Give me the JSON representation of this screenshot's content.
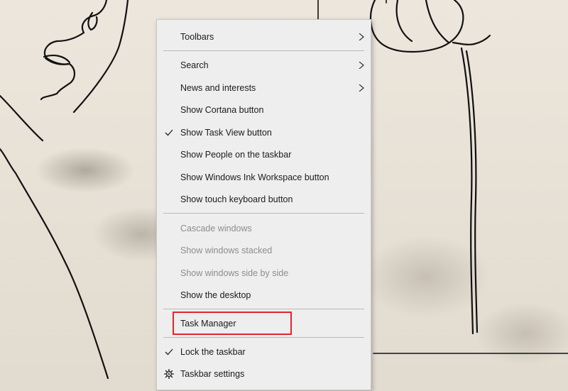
{
  "context_menu": {
    "items": [
      {
        "label": "Toolbars",
        "submenu": true
      },
      {
        "label": "Search",
        "submenu": true
      },
      {
        "label": "News and interests",
        "submenu": true
      },
      {
        "label": "Show Cortana button"
      },
      {
        "label": "Show Task View button",
        "checked": true
      },
      {
        "label": "Show People on the taskbar"
      },
      {
        "label": "Show Windows Ink Workspace button"
      },
      {
        "label": "Show touch keyboard button"
      },
      {
        "label": "Cascade windows",
        "disabled": true
      },
      {
        "label": "Show windows stacked",
        "disabled": true
      },
      {
        "label": "Show windows side by side",
        "disabled": true
      },
      {
        "label": "Show the desktop"
      },
      {
        "label": "Task Manager",
        "highlighted": true
      },
      {
        "label": "Lock the taskbar",
        "checked": true
      },
      {
        "label": "Taskbar settings",
        "icon": "gear-icon"
      }
    ]
  },
  "colors": {
    "menu_bg": "#eeeeee",
    "text": "#1b1b1b",
    "disabled_text": "#8d8d8d",
    "highlight_box": "#e0262b"
  }
}
